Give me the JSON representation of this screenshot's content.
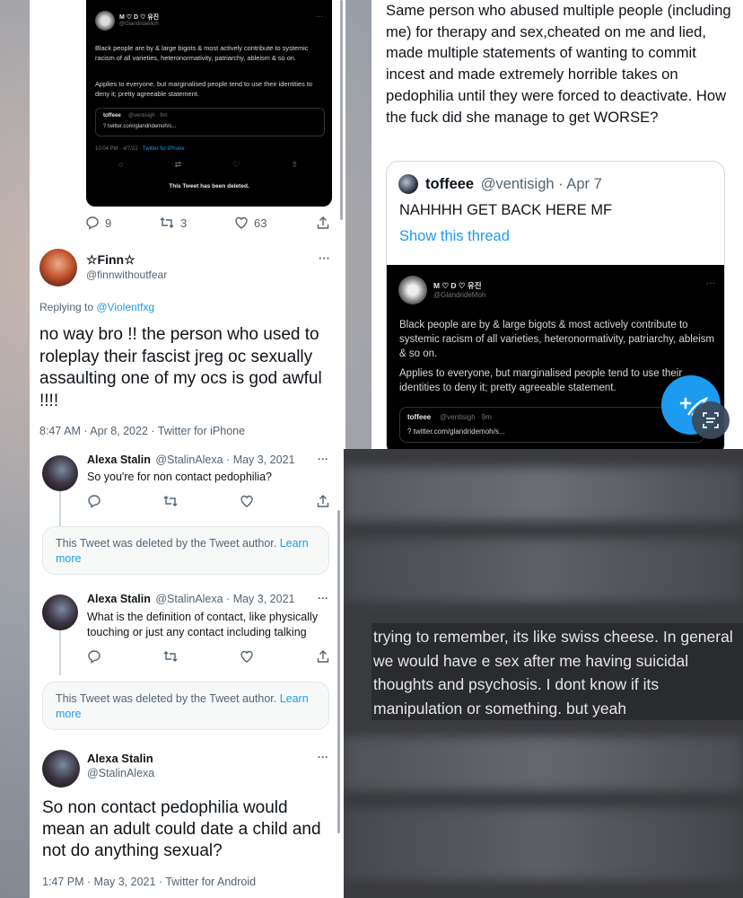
{
  "panelA": {
    "embed": {
      "name": "M ♡ D ♡ 유진",
      "handle": "@GlandrideMoh",
      "body1": "Black people are by & large bigots & most actively contribute to systemic racism of all varieties, heteronormativity, patriarchy, ableism & so on.",
      "body2": "Applies to everyone, but marginalised people tend to use their identities to deny it; pretty agreeable statement.",
      "quote_name": "toffeee",
      "quote_handle": "@ventisigh · 9m",
      "quote_link": "? twitter.com/glandridemoh/s...",
      "meta": "10:04 PM · 4/7/22 · ",
      "meta_link": "Twitter for iPhone",
      "deleted": "This Tweet has been deleted."
    },
    "actions": {
      "replies": "9",
      "retweets": "3",
      "likes": "63"
    },
    "reply": {
      "name": "☆Finn☆",
      "handle": "@finnwithoutfear",
      "replying_prefix": "Replying to ",
      "replying_to": "@Violentfxg",
      "text": "no way bro !! the person who used to roleplay their fascist jreg oc sexually assaulting one of my ocs is god awful !!!!",
      "meta": "8:47 AM · Apr 8, 2022 · Twitter for iPhone",
      "more": "···"
    }
  },
  "panelB": {
    "text": "Same person who abused multiple people (including me) for therapy and sex,cheated on me and lied, made multiple statements of wanting to commit incest and made extremely horrible takes on pedophilia until they were forced to deactivate. How the fuck did she manage to get WORSE?",
    "quote": {
      "name": "toffeee",
      "handle_date": "@ventisigh · Apr 7",
      "text": "NAHHHH GET BACK HERE MF",
      "show_thread": "Show this thread"
    },
    "embed": {
      "name": "M ♡ D ♡ 유진",
      "handle": "@GlandrideMoh",
      "body1": "Black people are by & large bigots & most actively contribute to systemic racism of all varieties, heteronormativity, patriarchy, ableism & so on.",
      "body2": "Applies to everyone, but marginalised people tend to use their identities to deny it; pretty agreeable statement.",
      "quote_name": "toffeee",
      "quote_handle": "@ventisigh · 9m",
      "quote_link": "? twitter.com/glandridemoh/s..."
    },
    "fab_icon": "compose-plus-icon",
    "scan_icon": "scan-icon"
  },
  "panelC": {
    "t1": {
      "name": "Alexa Stalin",
      "meta": "@StalinAlexa · May 3, 2021",
      "text": "So you're for non contact pedophilia?"
    },
    "deleted1": {
      "text": "This Tweet was deleted by the Tweet author. ",
      "link": "Learn more"
    },
    "t2": {
      "name": "Alexa Stalin",
      "meta": "@StalinAlexa · May 3, 2021",
      "text": "What is the definition of contact, like physically touching or just any contact including talking"
    },
    "deleted2": {
      "text": "This Tweet was deleted by the Tweet author. ",
      "link": "Learn more"
    },
    "t3": {
      "name": "Alexa Stalin",
      "handle": "@StalinAlexa",
      "text": "So non contact pedophilia would mean an adult could date a child and not do anything sexual?",
      "meta": "1:47 PM · May 3, 2021 · Twitter for Android"
    },
    "more": "···"
  },
  "panelD": {
    "text": "trying to remember, its like swiss cheese. In general we would have e sex after me having suicidal thoughts and psychosis. I dont know if its manipulation or something. but yeah"
  },
  "colors": {
    "accent": "#1d9bf0",
    "text": "#0f1419",
    "muted": "#536471"
  }
}
